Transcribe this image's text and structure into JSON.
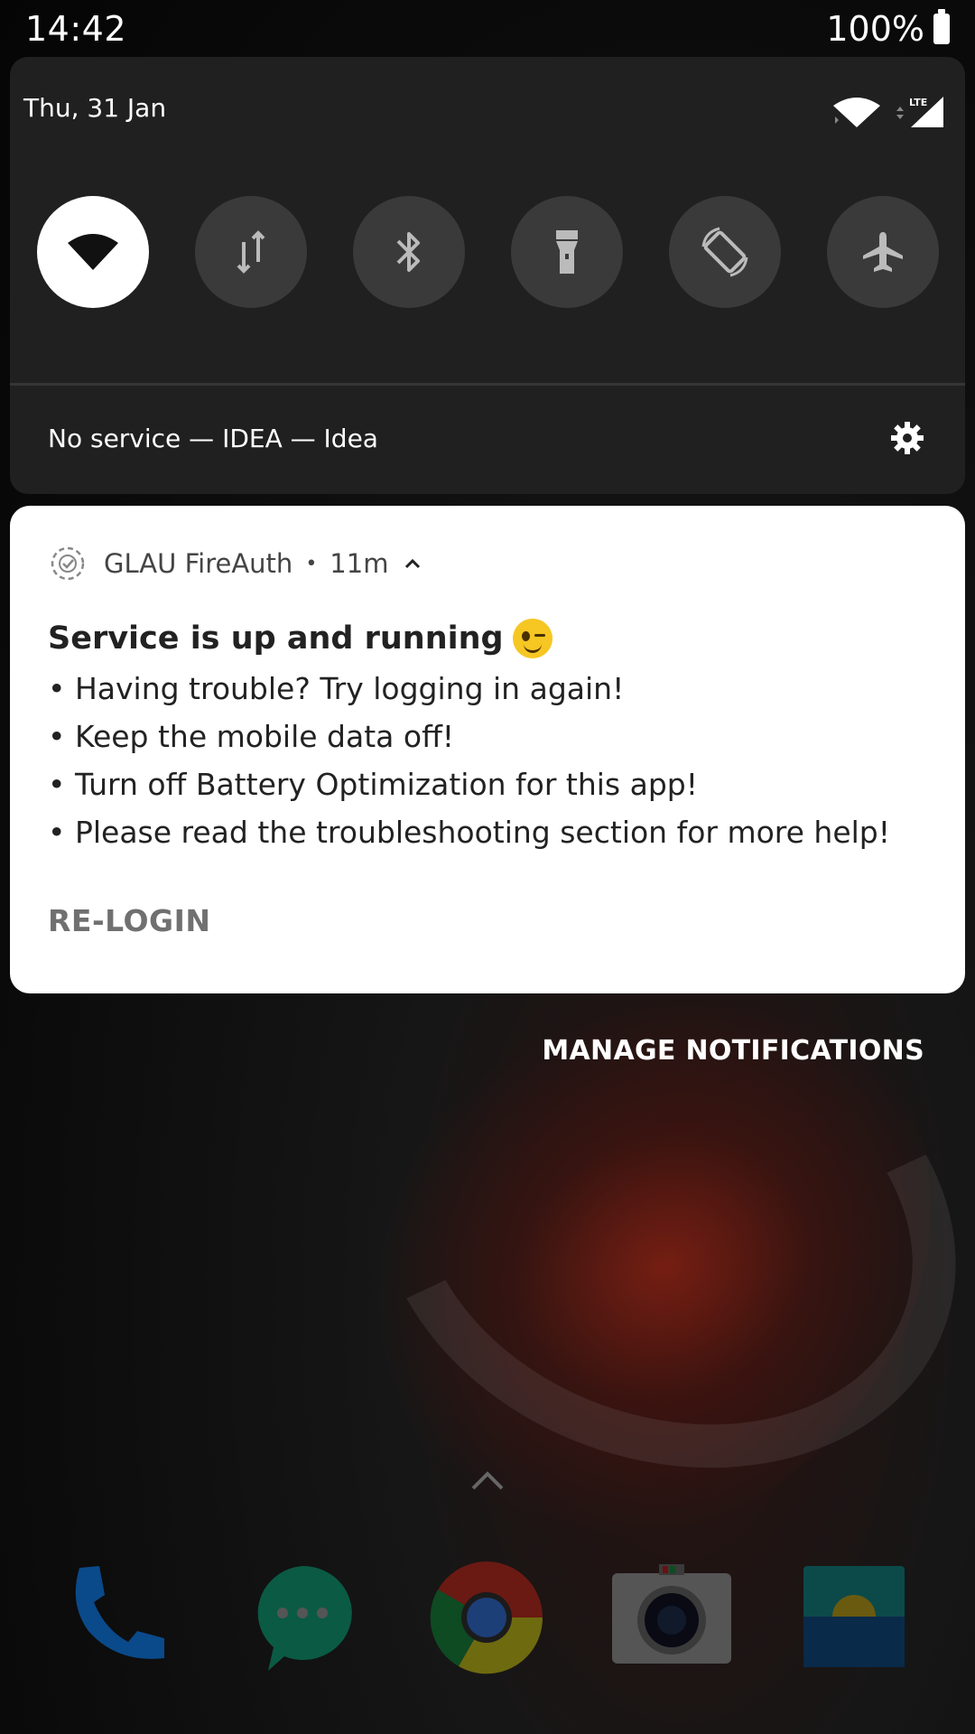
{
  "status_bar": {
    "time": "14:42",
    "battery": "100%",
    "battery_icon": "battery-full-icon"
  },
  "quick_settings": {
    "date": "Thu, 31 Jan",
    "network_type": "LTE",
    "tiles": [
      {
        "name": "wifi",
        "icon": "wifi-icon",
        "active": true
      },
      {
        "name": "mobile-data",
        "icon": "mobile-data-icon",
        "active": false
      },
      {
        "name": "bluetooth",
        "icon": "bluetooth-icon",
        "active": false
      },
      {
        "name": "flashlight",
        "icon": "flashlight-icon",
        "active": false
      },
      {
        "name": "auto-rotate",
        "icon": "auto-rotate-icon",
        "active": false
      },
      {
        "name": "airplane-mode",
        "icon": "airplane-icon",
        "active": false
      }
    ],
    "carrier_text": "No service — IDEA — Idea",
    "settings_icon": "gear-icon"
  },
  "notification": {
    "app_name": "GLAU FireAuth",
    "time_ago": "11m",
    "title": "Service is up and running",
    "lines": [
      "• Having trouble? Try logging in again!",
      "• Keep the mobile data off!",
      "• Turn off Battery Optimization for this app!",
      "• Please read the troubleshooting section for more help!"
    ],
    "action_label": "RE-LOGIN"
  },
  "manage_notifications_label": "MANAGE NOTIFICATIONS",
  "dock": [
    {
      "name": "phone",
      "icon": "phone-icon"
    },
    {
      "name": "messages",
      "icon": "messages-icon"
    },
    {
      "name": "chrome",
      "icon": "chrome-icon"
    },
    {
      "name": "camera",
      "icon": "camera-icon"
    },
    {
      "name": "gallery",
      "icon": "gallery-icon"
    }
  ],
  "colors": {
    "panel_bg": "#202020",
    "tile_inactive": "#3a3a3a",
    "tile_active": "#ffffff",
    "notification_bg": "#ffffff"
  }
}
